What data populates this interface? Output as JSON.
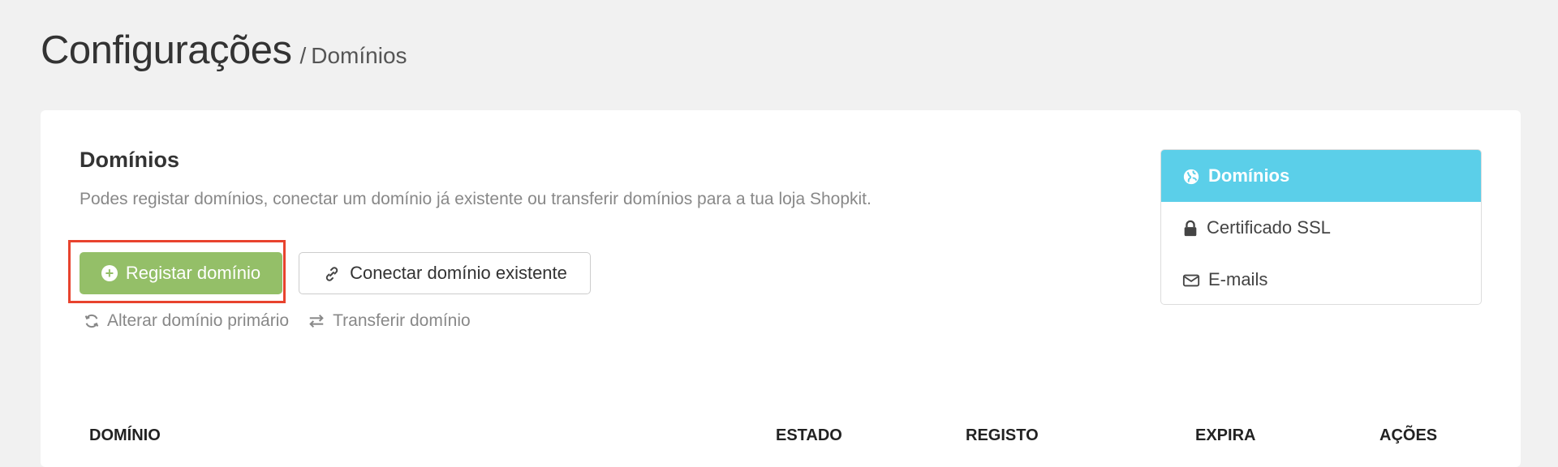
{
  "header": {
    "title": "Configurações",
    "separator": "/",
    "breadcrumb": "Domínios"
  },
  "section": {
    "title": "Domínios",
    "description": "Podes registar domínios, conectar um domínio já existente ou transferir domínios para a tua loja Shopkit."
  },
  "actions": {
    "register_label": "Registar domínio",
    "connect_label": "Conectar domínio existente",
    "change_primary_label": "Alterar domínio primário",
    "transfer_label": "Transferir domínio"
  },
  "side_menu": {
    "items": [
      {
        "label": "Domínios",
        "icon": "globe-icon",
        "active": true
      },
      {
        "label": "Certificado SSL",
        "icon": "lock-icon",
        "active": false
      },
      {
        "label": "E-mails",
        "icon": "envelope-icon",
        "active": false
      }
    ]
  },
  "table": {
    "columns": [
      "DOMÍNIO",
      "ESTADO",
      "REGISTO",
      "EXPIRA",
      "AÇÕES"
    ]
  },
  "colors": {
    "primary_button": "#94bf68",
    "active_menu": "#5bcfe9",
    "highlight_border": "#e8432e"
  }
}
